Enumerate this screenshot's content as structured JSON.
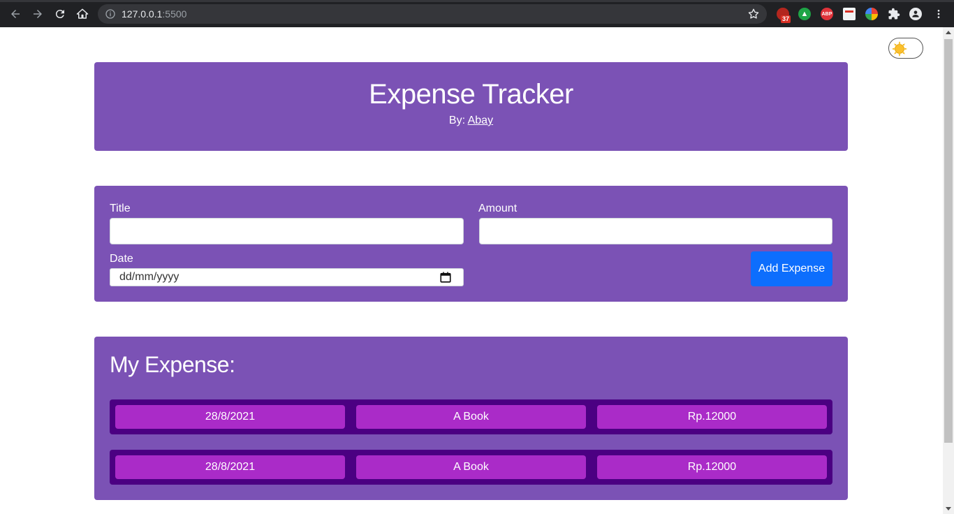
{
  "browser": {
    "url_host": "127.0.0.1",
    "url_port": ":5500",
    "ext_badge": "37",
    "ext_abp": "ABP"
  },
  "header": {
    "title": "Expense Tracker",
    "by_label": "By:",
    "author": "Abay"
  },
  "form": {
    "title_label": "Title",
    "amount_label": "Amount",
    "date_label": "Date",
    "date_placeholder": "dd/mm/yyyy",
    "add_button": "Add Expense"
  },
  "expenses": {
    "heading": "My Expense:",
    "rows": [
      {
        "date": "28/8/2021",
        "title": "A Book",
        "amount": "Rp.12000"
      },
      {
        "date": "28/8/2021",
        "title": "A Book",
        "amount": "Rp.12000"
      }
    ]
  },
  "colors": {
    "card": "#7b52b5",
    "row_bg": "#4b0082",
    "cell_bg": "#aa2bc8",
    "button": "#0d6efd"
  }
}
